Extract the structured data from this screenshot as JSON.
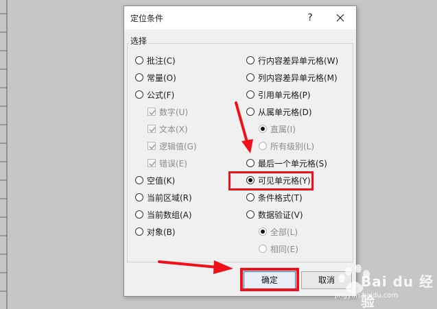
{
  "dialog": {
    "title": "定位条件",
    "help": "?",
    "group_label": "选择"
  },
  "left_options": [
    {
      "label": "批注(C)",
      "type": "radio",
      "checked": false,
      "disabled": false
    },
    {
      "label": "常量(O)",
      "type": "radio",
      "checked": false,
      "disabled": false
    },
    {
      "label": "公式(F)",
      "type": "radio",
      "checked": false,
      "disabled": false
    },
    {
      "label": "数字(U)",
      "type": "checkbox",
      "checked": true,
      "disabled": true
    },
    {
      "label": "文本(X)",
      "type": "checkbox",
      "checked": true,
      "disabled": true
    },
    {
      "label": "逻辑值(G)",
      "type": "checkbox",
      "checked": true,
      "disabled": true
    },
    {
      "label": "错误(E)",
      "type": "checkbox",
      "checked": true,
      "disabled": true
    },
    {
      "label": "空值(K)",
      "type": "radio",
      "checked": false,
      "disabled": false
    },
    {
      "label": "当前区域(R)",
      "type": "radio",
      "checked": false,
      "disabled": false
    },
    {
      "label": "当前数组(A)",
      "type": "radio",
      "checked": false,
      "disabled": false
    },
    {
      "label": "对象(B)",
      "type": "radio",
      "checked": false,
      "disabled": false
    }
  ],
  "right_options": [
    {
      "label": "行内容差异单元格(W)",
      "type": "radio",
      "checked": false,
      "disabled": false
    },
    {
      "label": "列内容差异单元格(M)",
      "type": "radio",
      "checked": false,
      "disabled": false
    },
    {
      "label": "引用单元格(P)",
      "type": "radio",
      "checked": false,
      "disabled": false
    },
    {
      "label": "从属单元格(D)",
      "type": "radio",
      "checked": false,
      "disabled": false
    },
    {
      "label": "直属(I)",
      "type": "radio",
      "checked": true,
      "disabled": true
    },
    {
      "label": "所有级别(L)",
      "type": "radio",
      "checked": false,
      "disabled": true
    },
    {
      "label": "最后一个单元格(S)",
      "type": "radio",
      "checked": false,
      "disabled": false
    },
    {
      "label": "可见单元格(Y)",
      "type": "radio",
      "checked": true,
      "disabled": false
    },
    {
      "label": "条件格式(T)",
      "type": "radio",
      "checked": false,
      "disabled": false
    },
    {
      "label": "数据验证(V)",
      "type": "radio",
      "checked": false,
      "disabled": false
    },
    {
      "label": "全部(L)",
      "type": "radio",
      "checked": true,
      "disabled": true
    },
    {
      "label": "相同(E)",
      "type": "radio",
      "checked": false,
      "disabled": true
    }
  ],
  "buttons": {
    "ok": "确定",
    "cancel": "取消"
  },
  "watermark": {
    "brand": "Bai du 经验",
    "url": "jingyan.baidu.com"
  },
  "colors": {
    "highlight": "#f0101a",
    "arrow": "#f0101a"
  }
}
